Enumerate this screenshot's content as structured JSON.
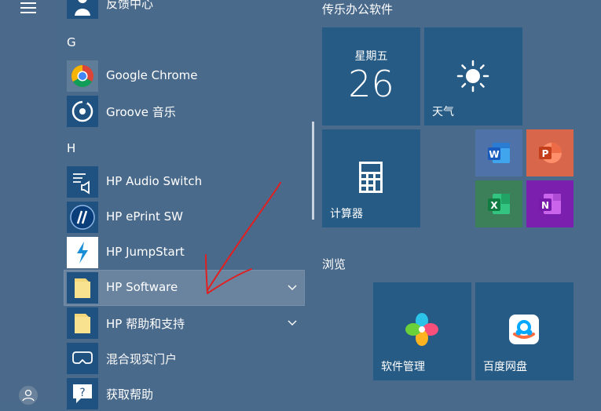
{
  "apps": [
    {
      "name": "反馈中心"
    },
    {
      "name": "Google Chrome"
    },
    {
      "name": "Groove 音乐"
    },
    {
      "name": "HP Audio Switch"
    },
    {
      "name": "HP ePrint SW"
    },
    {
      "name": "HP JumpStart"
    },
    {
      "name": "HP Software"
    },
    {
      "name": "HP 帮助和支持"
    },
    {
      "name": "混合现实门户"
    },
    {
      "name": "获取帮助"
    }
  ],
  "letters": [
    "G",
    "H"
  ],
  "groups": {
    "office": "传乐办公软件",
    "browse": "浏览"
  },
  "tiles": {
    "calendar_day": "星期五",
    "calendar_date": "26",
    "weather": "天气",
    "calculator": "计算器",
    "word_letter": "W",
    "ppt_letter": "P",
    "excel_letter": "X",
    "onenote_letter": "N",
    "software_manager": "软件管理",
    "baidu_netdisk": "百度网盘"
  },
  "colors": {
    "tile_blue": "#265b86",
    "word": "#2b579a",
    "powerpoint": "#d24726",
    "excel": "#217346",
    "onenote": "#7719aa",
    "annotation": "#e02020"
  }
}
